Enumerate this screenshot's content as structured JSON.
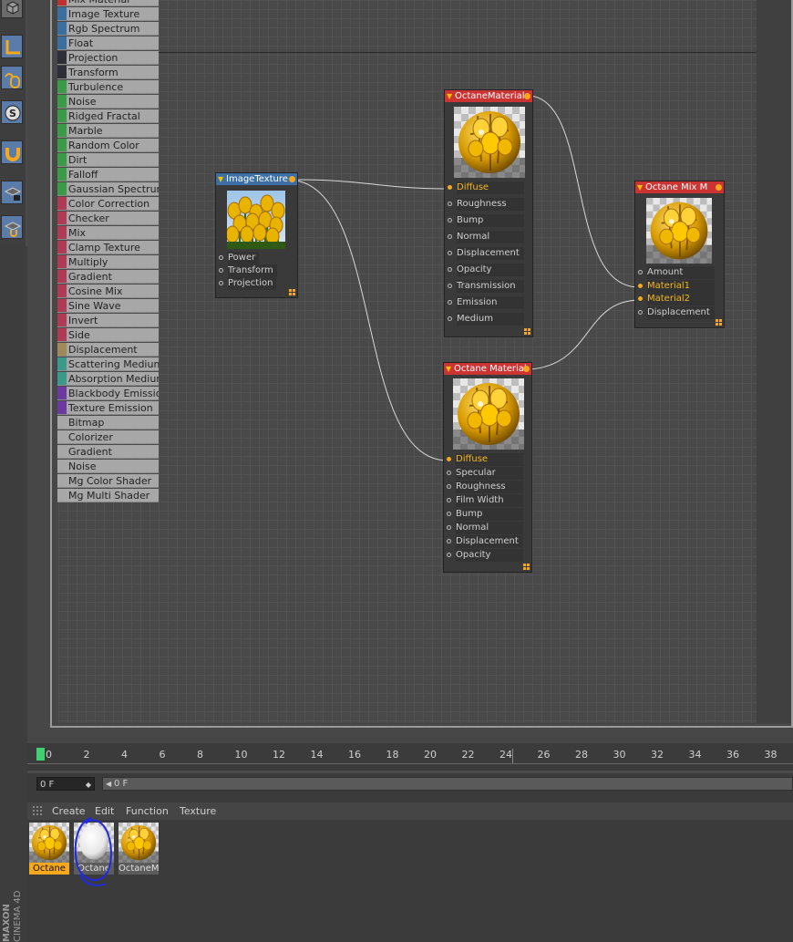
{
  "node_list": [
    {
      "label": "Mix Material",
      "color": "#c03030"
    },
    {
      "label": "Image Texture",
      "color": "#3a6fa0"
    },
    {
      "label": "Rgb Spectrum",
      "color": "#3a6fa0"
    },
    {
      "label": "Float",
      "color": "#3a6fa0"
    },
    {
      "label": "Projection",
      "color": "#2f2f3a"
    },
    {
      "label": "Transform",
      "color": "#2f2f3a"
    },
    {
      "label": "Turbulence",
      "color": "#3a9a45"
    },
    {
      "label": "Noise",
      "color": "#3a9a45"
    },
    {
      "label": "Ridged Fractal",
      "color": "#3a9a45"
    },
    {
      "label": "Marble",
      "color": "#3a9a45"
    },
    {
      "label": "Random Color",
      "color": "#3a9a45"
    },
    {
      "label": "Dirt",
      "color": "#3a9a45"
    },
    {
      "label": "Falloff",
      "color": "#3a9a45"
    },
    {
      "label": "Gaussian Spectrum",
      "color": "#3a9a45"
    },
    {
      "label": "Color Correction",
      "color": "#b03a55"
    },
    {
      "label": "Checker",
      "color": "#b03a55"
    },
    {
      "label": "Mix",
      "color": "#b03a55"
    },
    {
      "label": "Clamp Texture",
      "color": "#b03a55"
    },
    {
      "label": "Multiply",
      "color": "#b03a55"
    },
    {
      "label": "Gradient",
      "color": "#b03a55"
    },
    {
      "label": "Cosine Mix",
      "color": "#b03a55"
    },
    {
      "label": "Sine Wave",
      "color": "#b03a55"
    },
    {
      "label": "Invert",
      "color": "#b03a55"
    },
    {
      "label": "Side",
      "color": "#b03a55"
    },
    {
      "label": "Displacement",
      "color": "#a08a5a"
    },
    {
      "label": "Scattering Medium",
      "color": "#3a9a8a"
    },
    {
      "label": "Absorption Medium",
      "color": "#3a9a8a"
    },
    {
      "label": "Blackbody Emission",
      "color": "#6a3aa0"
    },
    {
      "label": "Texture Emission",
      "color": "#6a3aa0"
    },
    {
      "label": "Bitmap",
      "color": "#a7a7a7"
    },
    {
      "label": "Colorizer",
      "color": "#a7a7a7"
    },
    {
      "label": "Gradient",
      "color": "#a7a7a7"
    },
    {
      "label": "Noise",
      "color": "#a7a7a7"
    },
    {
      "label": "Mg Color Shader",
      "color": "#a7a7a7"
    },
    {
      "label": "Mg Multi Shader",
      "color": "#a7a7a7"
    }
  ],
  "nodes": {
    "image_texture": {
      "title": "ImageTexture",
      "header_color": "#3b6fa6",
      "ports": [
        "Power",
        "Transform",
        "Projection"
      ]
    },
    "octane_material_1": {
      "title": "OctaneMaterial",
      "header_color": "#cc3333",
      "ports": [
        "Diffuse",
        "Roughness",
        "Bump",
        "Normal",
        "Displacement",
        "Opacity",
        "Transmission",
        "Emission",
        "Medium"
      ]
    },
    "octane_material_2": {
      "title": "Octane Material",
      "header_color": "#cc3333",
      "ports": [
        "Diffuse",
        "Specular",
        "Roughness",
        "Film Width",
        "Bump",
        "Normal",
        "Displacement",
        "Opacity"
      ]
    },
    "octane_mix": {
      "title": "Octane Mix M",
      "header_color": "#cc3333",
      "ports": [
        "Amount",
        "Material1",
        "Material2",
        "Displacement"
      ]
    }
  },
  "timeline": {
    "ticks": [
      "0",
      "2",
      "4",
      "6",
      "8",
      "10",
      "12",
      "14",
      "16",
      "18",
      "20",
      "22",
      "24",
      "26",
      "28",
      "30",
      "32",
      "34",
      "36",
      "38"
    ],
    "current_frame": "0 F",
    "slider_label": "0 F"
  },
  "material_manager": {
    "menu": [
      "Create",
      "Edit",
      "Function",
      "Texture"
    ],
    "materials": [
      {
        "label": "Octane",
        "selected": true,
        "kind": "tulip"
      },
      {
        "label": "Octane",
        "selected": false,
        "kind": "egg"
      },
      {
        "label": "OctaneM",
        "selected": false,
        "kind": "tulip"
      }
    ]
  },
  "brand": {
    "line1": "MAXON",
    "line2": "CINEMA 4D"
  },
  "icons": [
    "cube-icon",
    "axis-icon",
    "mouse-icon",
    "snap-icon",
    "magnet-icon",
    "grid-lock-icon",
    "grid-magnet-icon"
  ]
}
